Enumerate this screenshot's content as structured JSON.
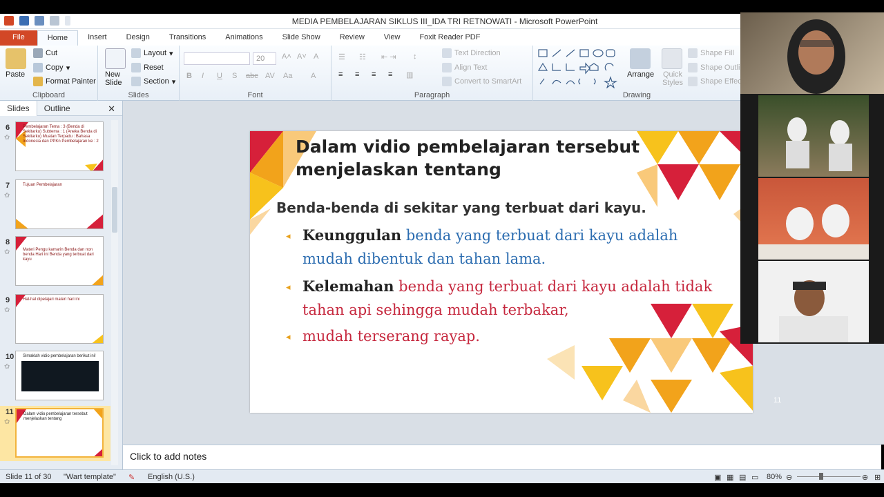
{
  "window": {
    "title": "MEDIA PEMBELAJARAN  SIKLUS III_IDA TRI RETNOWATI  -  Microsoft PowerPoint"
  },
  "tabs": [
    "File",
    "Home",
    "Insert",
    "Design",
    "Transitions",
    "Animations",
    "Slide Show",
    "Review",
    "View",
    "Foxit Reader PDF"
  ],
  "ribbon": {
    "clipboard": {
      "paste": "Paste",
      "cut": "Cut",
      "copy": "Copy",
      "format_painter": "Format Painter",
      "label": "Clipboard"
    },
    "slides": {
      "new_slide": "New Slide",
      "layout": "Layout",
      "reset": "Reset",
      "section": "Section",
      "label": "Slides"
    },
    "font": {
      "size": "20",
      "label": "Font"
    },
    "paragraph": {
      "text_direction": "Text Direction",
      "align_text": "Align Text",
      "smartart": "Convert to SmartArt",
      "label": "Paragraph"
    },
    "drawing": {
      "arrange": "Arrange",
      "quick_styles": "Quick Styles",
      "shape_fill": "Shape Fill",
      "shape_outline": "Shape Outline",
      "shape_effects": "Shape Effects",
      "label": "Drawing"
    }
  },
  "panel": {
    "tabs": [
      "Slides",
      "Outline"
    ],
    "thumbs": [
      {
        "num": "6",
        "text": "Pembelajaran  Tema : 3 (Benda di Sekitarku)  Subtema : 1 (Aneka Benda di Sekitarku)  Muatan Terpadu : Bahasa Indonesia dan PPKn  Pembelajaran ke : 2"
      },
      {
        "num": "7",
        "text": "Tujuan Pembelajaran"
      },
      {
        "num": "8",
        "text": "Materi  Pengu kamarin Benda dan non benda   Hari ini Benda yang terbuat dari kayu"
      },
      {
        "num": "9",
        "text": "Hal-hal dipelajari materi hari ini"
      },
      {
        "num": "10",
        "text": "Simaklah vidio pembelajaran berikut ini!"
      },
      {
        "num": "11",
        "text": "Dalam vidio pembelajaran tersebut menjelaskan tentang"
      }
    ]
  },
  "slide": {
    "title": "Dalam vidio pembelajaran tersebut menjelaskan tentang",
    "subtitle": "Benda-benda di sekitar yang terbuat dari kayu.",
    "bullets": [
      {
        "bold": "Keunggulan",
        "rest": " benda yang terbuat dari kayu adalah mudah dibentuk dan tahan lama."
      },
      {
        "bold": "Kelemahan",
        "rest": " benda yang terbuat dari kayu adalah tidak tahan api sehingga mudah terbakar,"
      },
      {
        "bold": "",
        "rest": "mudah terserang rayap."
      }
    ],
    "number": "11"
  },
  "notes": {
    "placeholder": "Click to add notes"
  },
  "status": {
    "slide": "Slide 11 of 30",
    "theme": "\"Wart template\"",
    "language": "English (U.S.)",
    "zoom": "80%"
  },
  "colors": {
    "accent_orange": "#f2a31b",
    "accent_red": "#d6203a",
    "accent_yellow": "#f7c21c",
    "file_tab": "#d24726"
  }
}
